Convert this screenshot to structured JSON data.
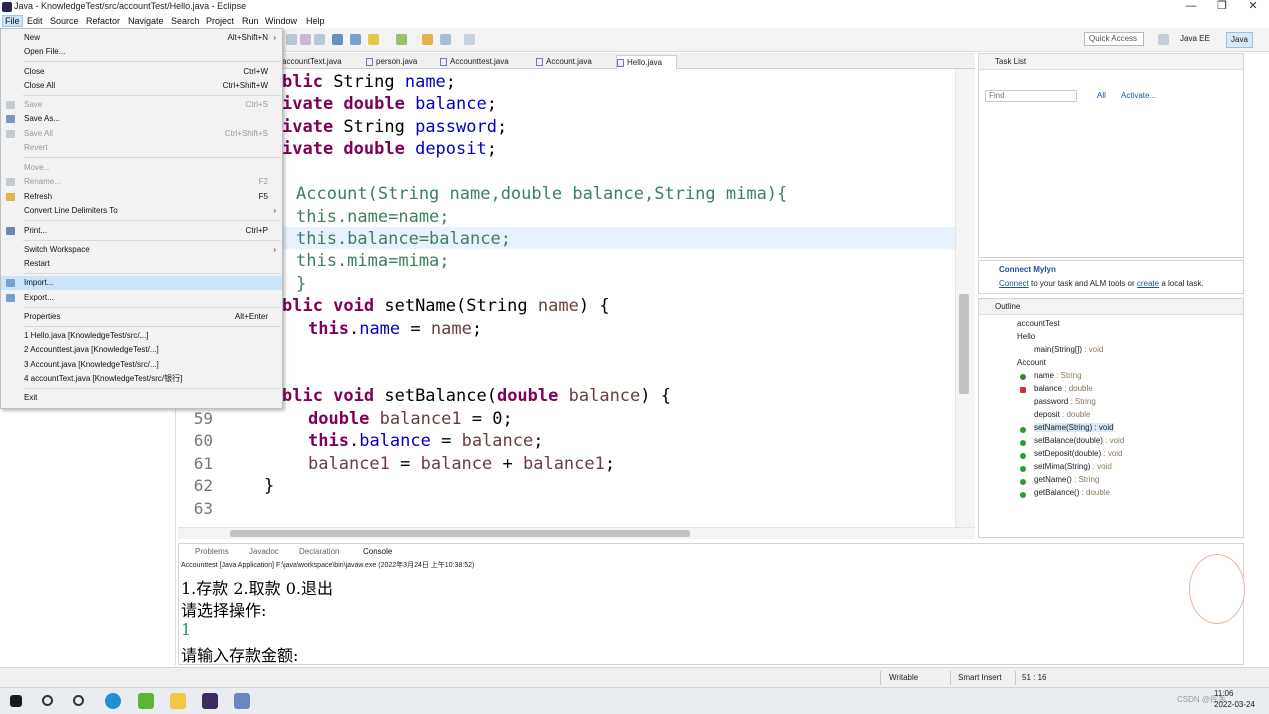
{
  "window": {
    "title": "Java - KnowledgeTest/src/accountTest/Hello.java - Eclipse",
    "minimize": "—",
    "maximize": "❐",
    "close": "✕"
  },
  "menubar": [
    "File",
    "Edit",
    "Source",
    "Refactor",
    "Navigate",
    "Search",
    "Project",
    "Run",
    "Window",
    "Help"
  ],
  "toolbar": {
    "quick_access_placeholder": "Quick Access",
    "perspectives": [
      "Java EE",
      "Java"
    ]
  },
  "editor": {
    "tabs": [
      "accountText.java",
      "person.java",
      "Accounttest.java",
      "Account.java",
      "Hello.java"
    ],
    "active_tab": "Hello.java",
    "lines": [
      {
        "num": "",
        "text": "blic String name;"
      },
      {
        "num": "",
        "text": "ivate double balance;"
      },
      {
        "num": "",
        "text": "ivate String password;"
      },
      {
        "num": "",
        "text": "ivate double deposit;"
      },
      {
        "num": "",
        "text": "Account(String name,double balance,String mima){"
      },
      {
        "num": "",
        "text": "this.name=name;"
      },
      {
        "num": "",
        "text": "this.balance=balance;"
      },
      {
        "num": "",
        "text": "this.mima=mima;"
      },
      {
        "num": "",
        "text": "}"
      },
      {
        "num": "",
        "text": "blic void setName(String name) {"
      },
      {
        "num": "",
        "text": "this.name = name;"
      },
      {
        "num": "",
        "text": "blic void setBalance(double balance) {"
      },
      {
        "num": "59",
        "text": "double balance1 = 0;"
      },
      {
        "num": "60",
        "text": "this.balance = balance;"
      },
      {
        "num": "61",
        "text": "balance1 = balance + balance1;"
      },
      {
        "num": "62",
        "text": "}"
      },
      {
        "num": "63",
        "text": ""
      }
    ]
  },
  "file_menu": {
    "items": [
      {
        "label": "New",
        "shortcut": "Alt+Shift+N",
        "submenu": true,
        "disabled": false
      },
      {
        "label": "Open File...",
        "shortcut": "",
        "disabled": false
      },
      {
        "label": "Close",
        "shortcut": "Ctrl+W",
        "disabled": false
      },
      {
        "label": "Close All",
        "shortcut": "Ctrl+Shift+W",
        "disabled": false
      },
      {
        "label": "Save",
        "shortcut": "Ctrl+S",
        "disabled": true
      },
      {
        "label": "Save As...",
        "shortcut": "",
        "disabled": false
      },
      {
        "label": "Save All",
        "shortcut": "Ctrl+Shift+S",
        "disabled": true
      },
      {
        "label": "Revert",
        "shortcut": "",
        "disabled": true
      },
      {
        "label": "Move...",
        "shortcut": "",
        "disabled": true
      },
      {
        "label": "Rename...",
        "shortcut": "F2",
        "disabled": true
      },
      {
        "label": "Refresh",
        "shortcut": "F5",
        "disabled": false
      },
      {
        "label": "Convert Line Delimiters To",
        "shortcut": "",
        "submenu": true,
        "disabled": false
      },
      {
        "label": "Print...",
        "shortcut": "Ctrl+P",
        "disabled": false
      },
      {
        "label": "Switch Workspace",
        "shortcut": "",
        "submenu": true,
        "disabled": false
      },
      {
        "label": "Restart",
        "shortcut": "",
        "disabled": false
      },
      {
        "label": "Import...",
        "shortcut": "",
        "disabled": false,
        "highlighted": true
      },
      {
        "label": "Export...",
        "shortcut": "",
        "disabled": false
      },
      {
        "label": "Properties",
        "shortcut": "Alt+Enter",
        "disabled": false
      },
      {
        "label": "1 Hello.java  [KnowledgeTest/src/...]",
        "shortcut": "",
        "disabled": false
      },
      {
        "label": "2 Accounttest.java  [KnowledgeTest/...]",
        "shortcut": "",
        "disabled": false
      },
      {
        "label": "3 Account.java  [KnowledgeTest/src/...]",
        "shortcut": "",
        "disabled": false
      },
      {
        "label": "4 accountText.java  [KnowledgeTest/src/银行]",
        "shortcut": "",
        "disabled": false
      },
      {
        "label": "Exit",
        "shortcut": "",
        "disabled": false
      }
    ]
  },
  "task_list": {
    "title": "Task List",
    "find_placeholder": "Find",
    "all": "All",
    "activate": "Activate..."
  },
  "mylyn": {
    "title": "Connect Mylyn",
    "connect": "Connect",
    "text1": " to your task and ALM tools or ",
    "create": "create",
    "text2": " a local task."
  },
  "outline": {
    "title": "Outline",
    "items": [
      {
        "name": "accountTest",
        "type": ""
      },
      {
        "name": "Hello",
        "type": ""
      },
      {
        "name": "main(String[])",
        "type": " : void"
      },
      {
        "name": "Account",
        "type": ""
      },
      {
        "name": "name",
        "type": " : String"
      },
      {
        "name": "balance",
        "type": " : double"
      },
      {
        "name": "password",
        "type": " : String"
      },
      {
        "name": "deposit",
        "type": " : double"
      },
      {
        "name": "setName(String)",
        "type": " : void"
      },
      {
        "name": "setBalance(double)",
        "type": " : void"
      },
      {
        "name": "setDeposit(double)",
        "type": " : void"
      },
      {
        "name": "setMima(String)",
        "type": " : void"
      },
      {
        "name": "getName()",
        "type": " : String"
      },
      {
        "name": "getBalance()",
        "type": " : double"
      }
    ]
  },
  "console": {
    "tabs": [
      "Problems",
      "Javadoc",
      "Declaration",
      "Console"
    ],
    "header": "Accounttest [Java Application] F:\\java\\workspace\\bin\\javaw.exe (2022年3月24日 上午10:38:52)",
    "lines": [
      "1.存款 2.取款 0.退出",
      "请选择操作:",
      "1",
      "请输入存款金额:"
    ]
  },
  "statusbar": {
    "writable": "Writable",
    "insert": "Smart Insert",
    "position": "51 : 16"
  },
  "taskbar": {
    "time": "11:06",
    "date": "2022-03-24",
    "csdn": "CSDN @挥手"
  }
}
